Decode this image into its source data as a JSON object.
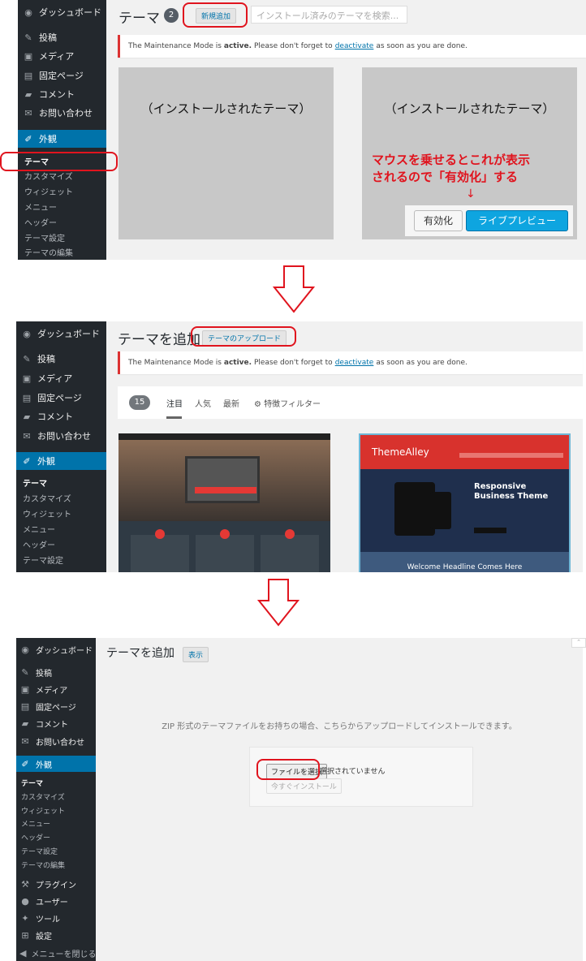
{
  "sidebar": {
    "dashboard": "ダッシュボード",
    "posts": "投稿",
    "media": "メディア",
    "pages": "固定ページ",
    "comments": "コメント",
    "contact": "お問い合わせ",
    "appearance": "外観",
    "themes": "テーマ",
    "customize": "カスタマイズ",
    "widgets": "ウィジェット",
    "menus": "メニュー",
    "header": "ヘッダー",
    "theme_settings": "テーマ設定",
    "theme_editor": "テーマの編集",
    "plugins": "プラグイン",
    "users": "ユーザー",
    "tools": "ツール",
    "settings": "設定",
    "collapse": "メニューを閉じる"
  },
  "panel1": {
    "title": "テーマ",
    "count": "2",
    "add_new": "新規追加",
    "search_placeholder": "インストール済みのテーマを検索...",
    "installed_theme_1": "（インストールされたテーマ）",
    "installed_theme_2": "（インストールされたテーマ）",
    "annotation_line1": "マウスを乗せるとこれが表示",
    "annotation_line2": "されるので「有効化」する",
    "annotation_arrow": "↓",
    "activate_button": "有効化",
    "live_preview_button": "ライブプレビュー"
  },
  "notice": {
    "prefix": "The Maintenance Mode is",
    "status": "active.",
    "middle": "Please don't forget to",
    "link": "deactivate",
    "suffix": "as soon as you are done."
  },
  "panel2": {
    "title": "テーマを追加",
    "upload_button": "テーマのアップロード",
    "count": "15",
    "tabs": [
      "注目",
      "人気",
      "最新"
    ],
    "feature_filter": "特徴フィルター",
    "theme2_brand": "ThemeAlley",
    "theme2_headline_1": "Responsive",
    "theme2_headline_2": "Business Theme",
    "theme2_footer": "Welcome Headline Comes Here"
  },
  "panel3": {
    "title": "テーマを追加",
    "show_button": "表示",
    "description": "ZIP 形式のテーマファイルをお持ちの場合、こちらからアップロードしてインストールできます。",
    "choose_file": "ファイルを選択",
    "no_file": "選択されていません",
    "install_now": "今すぐインストール"
  },
  "colors": {
    "accent": "#0073aa",
    "sidebar": "#23282d",
    "annotation": "#e0141e",
    "notice_border": "#dc3232"
  }
}
